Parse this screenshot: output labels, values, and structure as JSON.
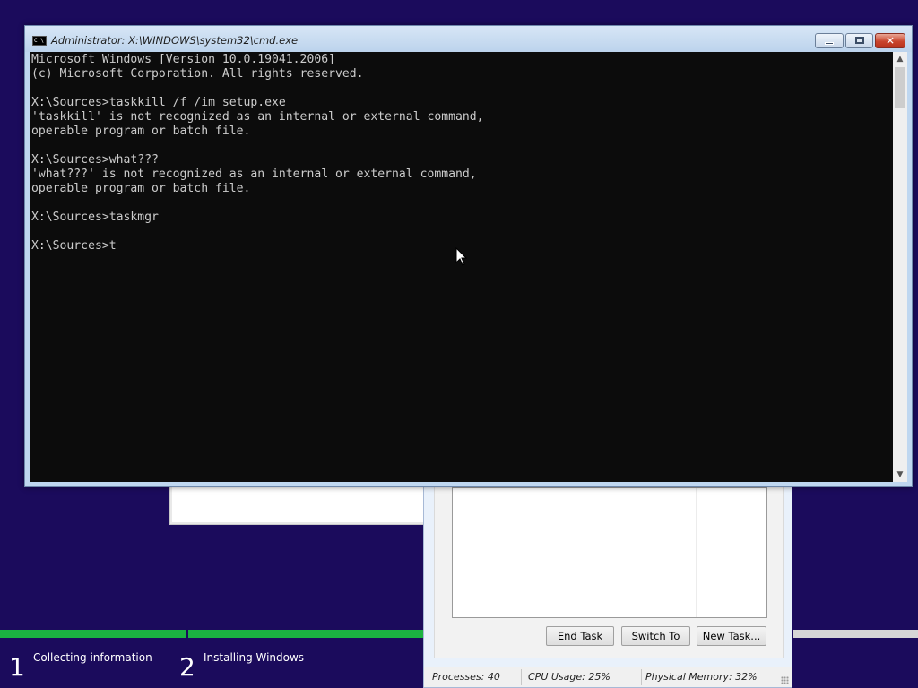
{
  "setup": {
    "steps": [
      {
        "number": "1",
        "label": "Collecting information"
      },
      {
        "number": "2",
        "label": "Installing Windows"
      }
    ],
    "progress_colors": {
      "complete": "#1bb341",
      "pending": "#d6d6d6"
    }
  },
  "taskmgr": {
    "buttons": {
      "end_task": {
        "u": "E",
        "rest": "nd Task"
      },
      "switch_to": {
        "u": "S",
        "rest": "witch To"
      },
      "new_task": {
        "u": "N",
        "rest": "ew Task..."
      }
    },
    "status": {
      "processes": "Processes: 40",
      "cpu": "CPU Usage: 25%",
      "memory": "Physical Memory: 32%"
    }
  },
  "cmd": {
    "title": "Administrator: X:\\WINDOWS\\system32\\cmd.exe",
    "icon_text": "C:\\",
    "icon": "console-icon",
    "console_text": "Microsoft Windows [Version 10.0.19041.2006]\n(c) Microsoft Corporation. All rights reserved.\n\nX:\\Sources>taskkill /f /im setup.exe\n'taskkill' is not recognized as an internal or external command,\noperable program or batch file.\n\nX:\\Sources>what???\n'what???' is not recognized as an internal or external command,\noperable program or batch file.\n\nX:\\Sources>taskmgr\n\nX:\\Sources>t",
    "close_glyph": "✕",
    "scroll_up": "▲",
    "scroll_down": "▼"
  }
}
